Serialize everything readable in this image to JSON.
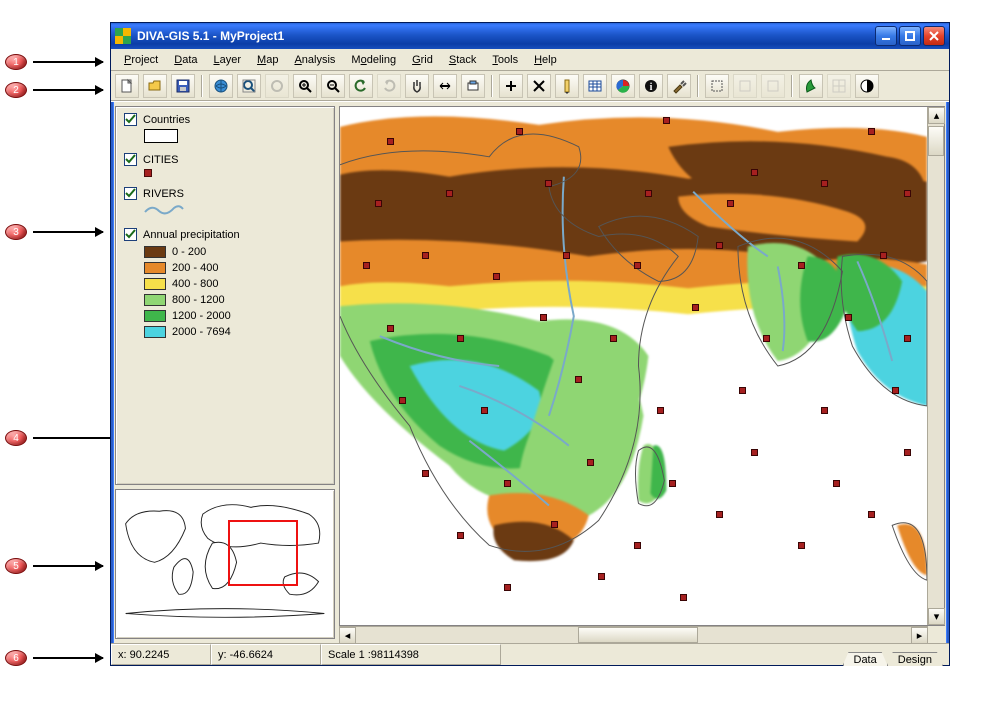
{
  "title": "DIVA-GIS 5.1 - MyProject1",
  "menu": [
    "Project",
    "Data",
    "Layer",
    "Map",
    "Analysis",
    "Modeling",
    "Grid",
    "Stack",
    "Tools",
    "Help"
  ],
  "toolbar_names": [
    "new",
    "open",
    "save",
    "sep",
    "globe",
    "zoom-extent",
    "zoom-prev",
    "zoom-in",
    "zoom-out",
    "undo",
    "redo",
    "pan",
    "measure",
    "snapshot",
    "sep",
    "add",
    "remove",
    "identify",
    "table",
    "filter",
    "info",
    "tools",
    "sep",
    "select-rect",
    "select-poly",
    "select-clear",
    "sep",
    "diva",
    "grid-tool",
    "contrast"
  ],
  "layers": [
    {
      "name": "Countries",
      "checked": true,
      "type": "rect"
    },
    {
      "name": "CITIES",
      "checked": true,
      "type": "city"
    },
    {
      "name": "RIVERS",
      "checked": true,
      "type": "river"
    },
    {
      "name": "Annual precipitation",
      "checked": true,
      "type": "precip"
    }
  ],
  "precip_legend": [
    {
      "label": "0 - 200",
      "color": "#6b3a12"
    },
    {
      "label": "200 - 400",
      "color": "#e6892a"
    },
    {
      "label": "400 - 800",
      "color": "#f6e04a"
    },
    {
      "label": "800 - 1200",
      "color": "#8fd673"
    },
    {
      "label": "1200 - 2000",
      "color": "#3fb64b"
    },
    {
      "label": "2000 - 7694",
      "color": "#4cd3e0"
    }
  ],
  "status": {
    "x": "x: 90.2245",
    "y": "y: -46.6624",
    "scale": "Scale 1 :98114398"
  },
  "tabs": [
    "Data",
    "Design"
  ],
  "callouts": [
    "1",
    "2",
    "3",
    "4",
    "5",
    "6"
  ]
}
